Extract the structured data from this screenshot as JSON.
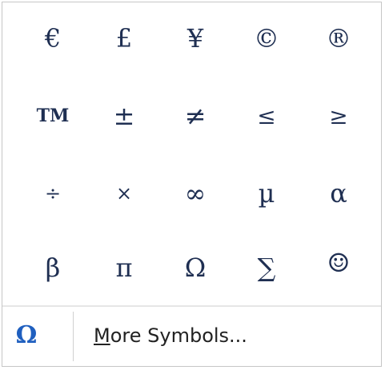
{
  "symbols": [
    [
      "€",
      "£",
      "¥",
      "©",
      "®"
    ],
    [
      "TM",
      "±",
      "≠",
      "≤",
      "≥"
    ],
    [
      "÷",
      "×",
      "∞",
      "µ",
      "α"
    ],
    [
      "β",
      "π",
      "Ω",
      "∑",
      "☺"
    ]
  ],
  "footer": {
    "icon": "Ω",
    "more_first": "M",
    "more_rest": "ore Symbols..."
  }
}
